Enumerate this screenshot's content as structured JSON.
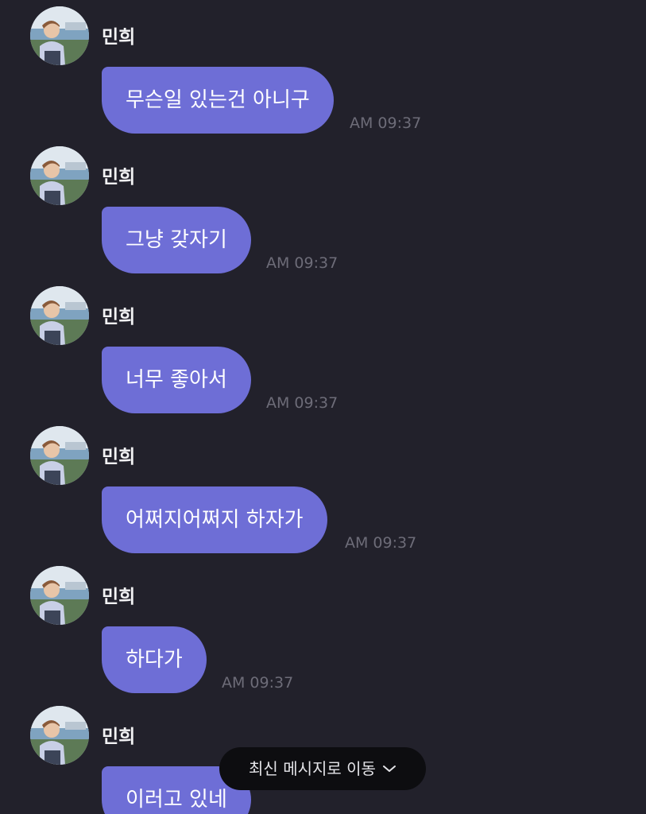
{
  "chat": {
    "sender_name": "민희",
    "messages": [
      {
        "sender": "민희",
        "text": "무슨일 있는건 아니구",
        "time": "AM 09:37"
      },
      {
        "sender": "민희",
        "text": "그냥 갖자기",
        "time": "AM 09:37"
      },
      {
        "sender": "민희",
        "text": "너무 좋아서",
        "time": "AM 09:37"
      },
      {
        "sender": "민희",
        "text": "어쩌지어쩌지 하자가",
        "time": "AM 09:37"
      },
      {
        "sender": "민희",
        "text": "하다가",
        "time": "AM 09:37"
      },
      {
        "sender": "민희",
        "text": "이러고 있네",
        "time": ""
      }
    ]
  },
  "scroll_to_latest": {
    "label": "최신 메시지로 이동",
    "icon": "chevron-down-icon"
  },
  "colors": {
    "background": "#22212b",
    "bubble": "#6e6ed6",
    "timestamp": "#6d6c78",
    "pill": "#0d0d10"
  }
}
